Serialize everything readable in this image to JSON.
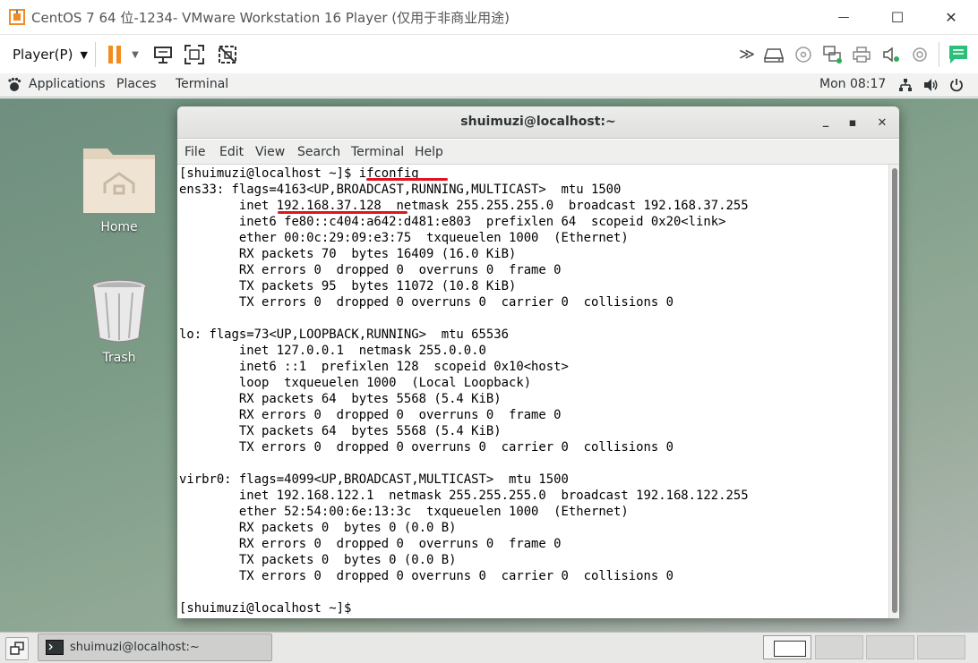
{
  "vm_window": {
    "title": "CentOS 7 64 位-1234- VMware Workstation 16 Player (仅用于非商业用途)",
    "minimize_label": "—",
    "maximize_label": "☐",
    "close_label": "✕"
  },
  "vm_toolbar": {
    "player_menu_label": "Player(P)",
    "icons": [
      "pause-icon",
      "pause-dropdown-icon",
      "send-ctrl-alt-del-icon",
      "full-screen-icon",
      "unity-icon",
      "forward-icon",
      "hard-disk-icon",
      "cd-icon",
      "network-adapter-icon",
      "printer-icon",
      "sound-icon",
      "usb-icon",
      "message-icon"
    ]
  },
  "gnome_topbar": {
    "applications": "Applications",
    "places": "Places",
    "terminal": "Terminal",
    "clock": "Mon 08:17"
  },
  "desktop": {
    "icons": [
      {
        "label": "Home"
      },
      {
        "label": "Trash"
      }
    ]
  },
  "terminal": {
    "title": "shuimuzi@localhost:~",
    "minimize_label": "_",
    "maximize_label": "▪",
    "close_label": "✕",
    "menu": [
      "File",
      "Edit",
      "View",
      "Search",
      "Terminal",
      "Help"
    ],
    "lines": [
      "[shuimuzi@localhost ~]$ ifconfig",
      "ens33: flags=4163<UP,BROADCAST,RUNNING,MULTICAST>  mtu 1500",
      "        inet 192.168.37.128  netmask 255.255.255.0  broadcast 192.168.37.255",
      "        inet6 fe80::c404:a642:d481:e803  prefixlen 64  scopeid 0x20<link>",
      "        ether 00:0c:29:09:e3:75  txqueuelen 1000  (Ethernet)",
      "        RX packets 70  bytes 16409 (16.0 KiB)",
      "        RX errors 0  dropped 0  overruns 0  frame 0",
      "        TX packets 95  bytes 11072 (10.8 KiB)",
      "        TX errors 0  dropped 0 overruns 0  carrier 0  collisions 0",
      "",
      "lo: flags=73<UP,LOOPBACK,RUNNING>  mtu 65536",
      "        inet 127.0.0.1  netmask 255.0.0.0",
      "        inet6 ::1  prefixlen 128  scopeid 0x10<host>",
      "        loop  txqueuelen 1000  (Local Loopback)",
      "        RX packets 64  bytes 5568 (5.4 KiB)",
      "        RX errors 0  dropped 0  overruns 0  frame 0",
      "        TX packets 64  bytes 5568 (5.4 KiB)",
      "        TX errors 0  dropped 0 overruns 0  carrier 0  collisions 0",
      "",
      "virbr0: flags=4099<UP,BROADCAST,MULTICAST>  mtu 1500",
      "        inet 192.168.122.1  netmask 255.255.255.0  broadcast 192.168.122.255",
      "        ether 52:54:00:6e:13:3c  txqueuelen 1000  (Ethernet)",
      "        RX packets 0  bytes 0 (0.0 B)",
      "        RX errors 0  dropped 0  overruns 0  frame 0",
      "        TX packets 0  bytes 0 (0.0 B)",
      "        TX errors 0  dropped 0 overruns 0  carrier 0  collisions 0",
      "",
      "[shuimuzi@localhost ~]$"
    ],
    "annotation_color": "#e0141e"
  },
  "bottom_bar": {
    "task_label": "shuimuzi@localhost:~"
  },
  "colors": {
    "vmware_accent": "#f28b20",
    "message_icon": "#2bbf7a"
  }
}
